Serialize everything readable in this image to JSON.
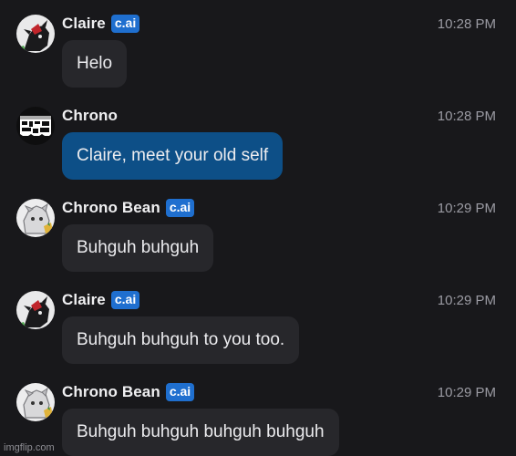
{
  "messages": [
    {
      "sender": "Claire",
      "badge": "c.ai",
      "time": "10:28 PM",
      "text": "Helo",
      "avatar_icon": "claire-avatar-icon",
      "is_user": false
    },
    {
      "sender": "Chrono",
      "badge": "",
      "time": "10:28 PM",
      "text": "Claire, meet your old self",
      "avatar_icon": "chrono-avatar-icon",
      "is_user": true
    },
    {
      "sender": "Chrono Bean",
      "badge": "c.ai",
      "time": "10:29 PM",
      "text": "Buhguh buhguh",
      "avatar_icon": "chrono-bean-avatar-icon",
      "is_user": false
    },
    {
      "sender": "Claire",
      "badge": "c.ai",
      "time": "10:29 PM",
      "text": "Buhguh buhguh to you too.",
      "avatar_icon": "claire-avatar-icon",
      "is_user": false
    },
    {
      "sender": "Chrono Bean",
      "badge": "c.ai",
      "time": "10:29 PM",
      "text": "Buhguh buhguh buhguh buhguh",
      "avatar_icon": "chrono-bean-avatar-icon",
      "is_user": false
    }
  ],
  "watermark": "imgflip.com",
  "colors": {
    "background": "#18181b",
    "bubble": "#27272b",
    "user_bubble": "#0d4f87",
    "badge": "#1f6fcf"
  }
}
